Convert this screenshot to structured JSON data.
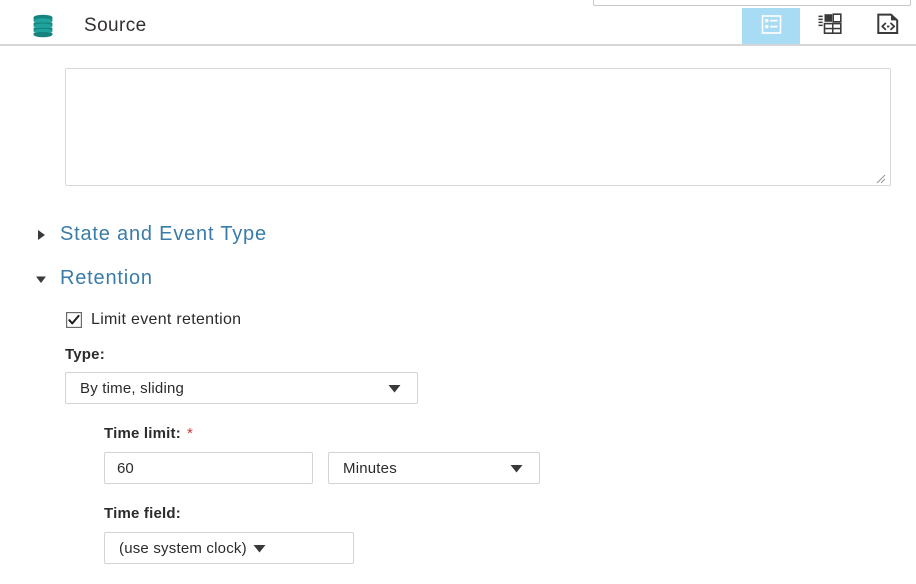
{
  "window": {
    "title": "Source",
    "source_icon": "database-icon"
  },
  "top_clipped": {
    "note": "partially visible text input above header"
  },
  "header": {
    "title": "Source",
    "tabs": [
      {
        "id": "form-view",
        "icon": "form-list-icon",
        "active": true
      },
      {
        "id": "table-view",
        "icon": "table-grid-icon",
        "active": false
      },
      {
        "id": "code-view",
        "icon": "code-page-icon",
        "active": false
      }
    ],
    "active_tab_color": "#a8dcf5"
  },
  "form": {
    "clipped_label": "",
    "description_textarea": {
      "value": "",
      "placeholder": ""
    },
    "sections": [
      {
        "id": "state-and-event-type",
        "label": "State and Event Type",
        "expanded": false,
        "marker": "▶"
      },
      {
        "id": "retention",
        "label": "Retention",
        "expanded": true,
        "marker": "▼"
      }
    ],
    "retention": {
      "limit_checkbox": {
        "label": "Limit event retention",
        "checked": true
      },
      "type": {
        "label": "Type:",
        "value": "By time, sliding"
      },
      "time_limit": {
        "label": "Time limit:",
        "required_marker": "*",
        "value": "60",
        "unit": "Minutes"
      },
      "time_field": {
        "label": "Time field:",
        "value": "(use system clock)"
      }
    }
  },
  "colors": {
    "section_heading": "#3a7ca8",
    "db_icon": "#17837f",
    "required": "#d03636",
    "tab_active_bg": "#a8dcf5",
    "border": "#d3d3d3"
  }
}
